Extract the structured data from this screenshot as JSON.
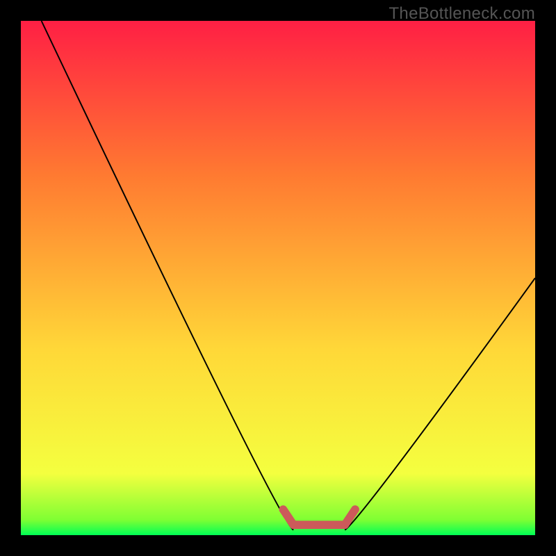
{
  "watermark": "TheBottleneck.com",
  "chart_data": {
    "type": "line",
    "title": "",
    "xlabel": "",
    "ylabel": "",
    "xlim": [
      0,
      100
    ],
    "ylim": [
      0,
      100
    ],
    "curve_left": {
      "description": "left branch of V-shaped bottleneck curve",
      "points": [
        {
          "x": 4,
          "y": 100
        },
        {
          "x": 50,
          "y": 3
        },
        {
          "x": 53,
          "y": 1
        }
      ]
    },
    "curve_right": {
      "description": "right branch of V-shaped bottleneck curve",
      "points": [
        {
          "x": 63,
          "y": 1
        },
        {
          "x": 66,
          "y": 3
        },
        {
          "x": 100,
          "y": 50
        }
      ]
    },
    "highlight_segment": {
      "description": "thick red rounded segment at valley floor",
      "points": [
        {
          "x": 51,
          "y": 5
        },
        {
          "x": 53,
          "y": 2
        },
        {
          "x": 63,
          "y": 2
        },
        {
          "x": 65,
          "y": 5
        }
      ],
      "color": "#cc5a5a",
      "stroke_width_pct": 1.6
    },
    "gradient_stops": [
      {
        "pct": 0,
        "color": "#00ff55"
      },
      {
        "pct": 3,
        "color": "#7fff33"
      },
      {
        "pct": 12,
        "color": "#f4ff3f"
      },
      {
        "pct": 36,
        "color": "#ffd838"
      },
      {
        "pct": 70,
        "color": "#ff7a31"
      },
      {
        "pct": 100,
        "color": "#ff1f44"
      }
    ]
  }
}
